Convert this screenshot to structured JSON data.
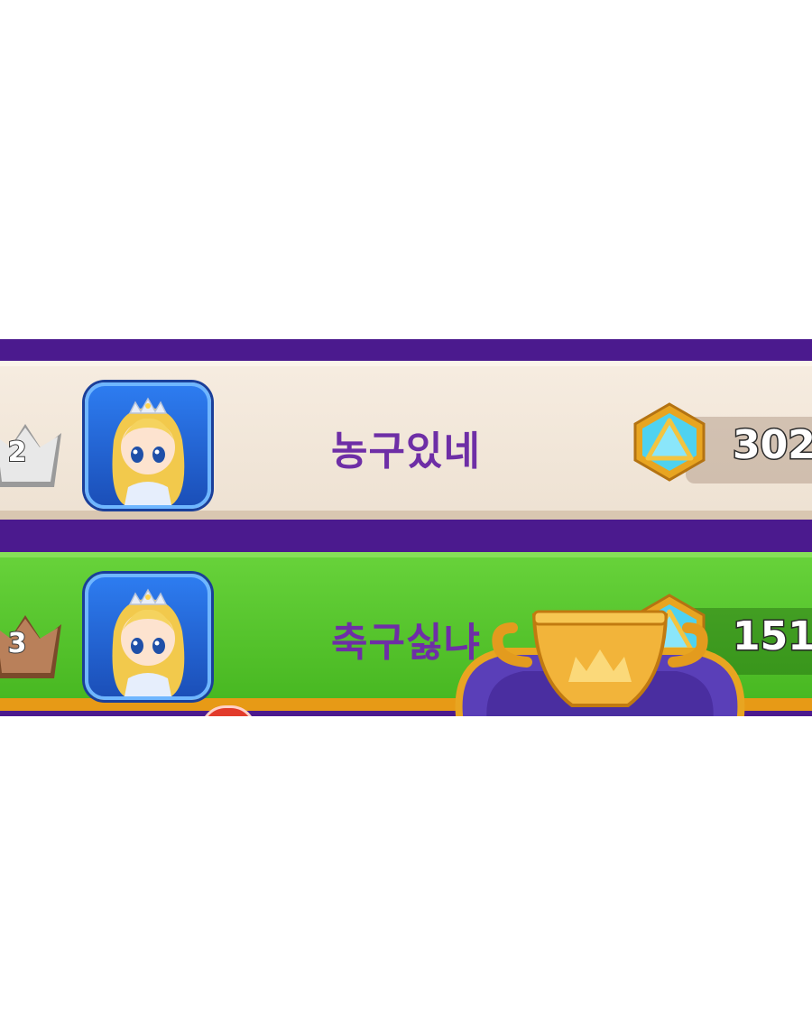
{
  "leaderboard": {
    "rows": [
      {
        "rank": "2",
        "rank_icon": "silver-crown-icon",
        "avatar": "princess-avatar",
        "name": "농구있네",
        "score_icon": "blue-gem-icon",
        "score": "302"
      },
      {
        "rank": "3",
        "rank_icon": "bronze-crown-icon",
        "avatar": "princess-avatar",
        "name": "축구싫냐",
        "score_icon": "blue-gem-icon",
        "score": "151"
      }
    ],
    "overlay_icon": "trophy-icon",
    "colors": {
      "frame": "#4b1a8e",
      "row_highlight": "#54c22a",
      "row_default": "#f3e8da",
      "name": "#6e2ea6"
    }
  }
}
